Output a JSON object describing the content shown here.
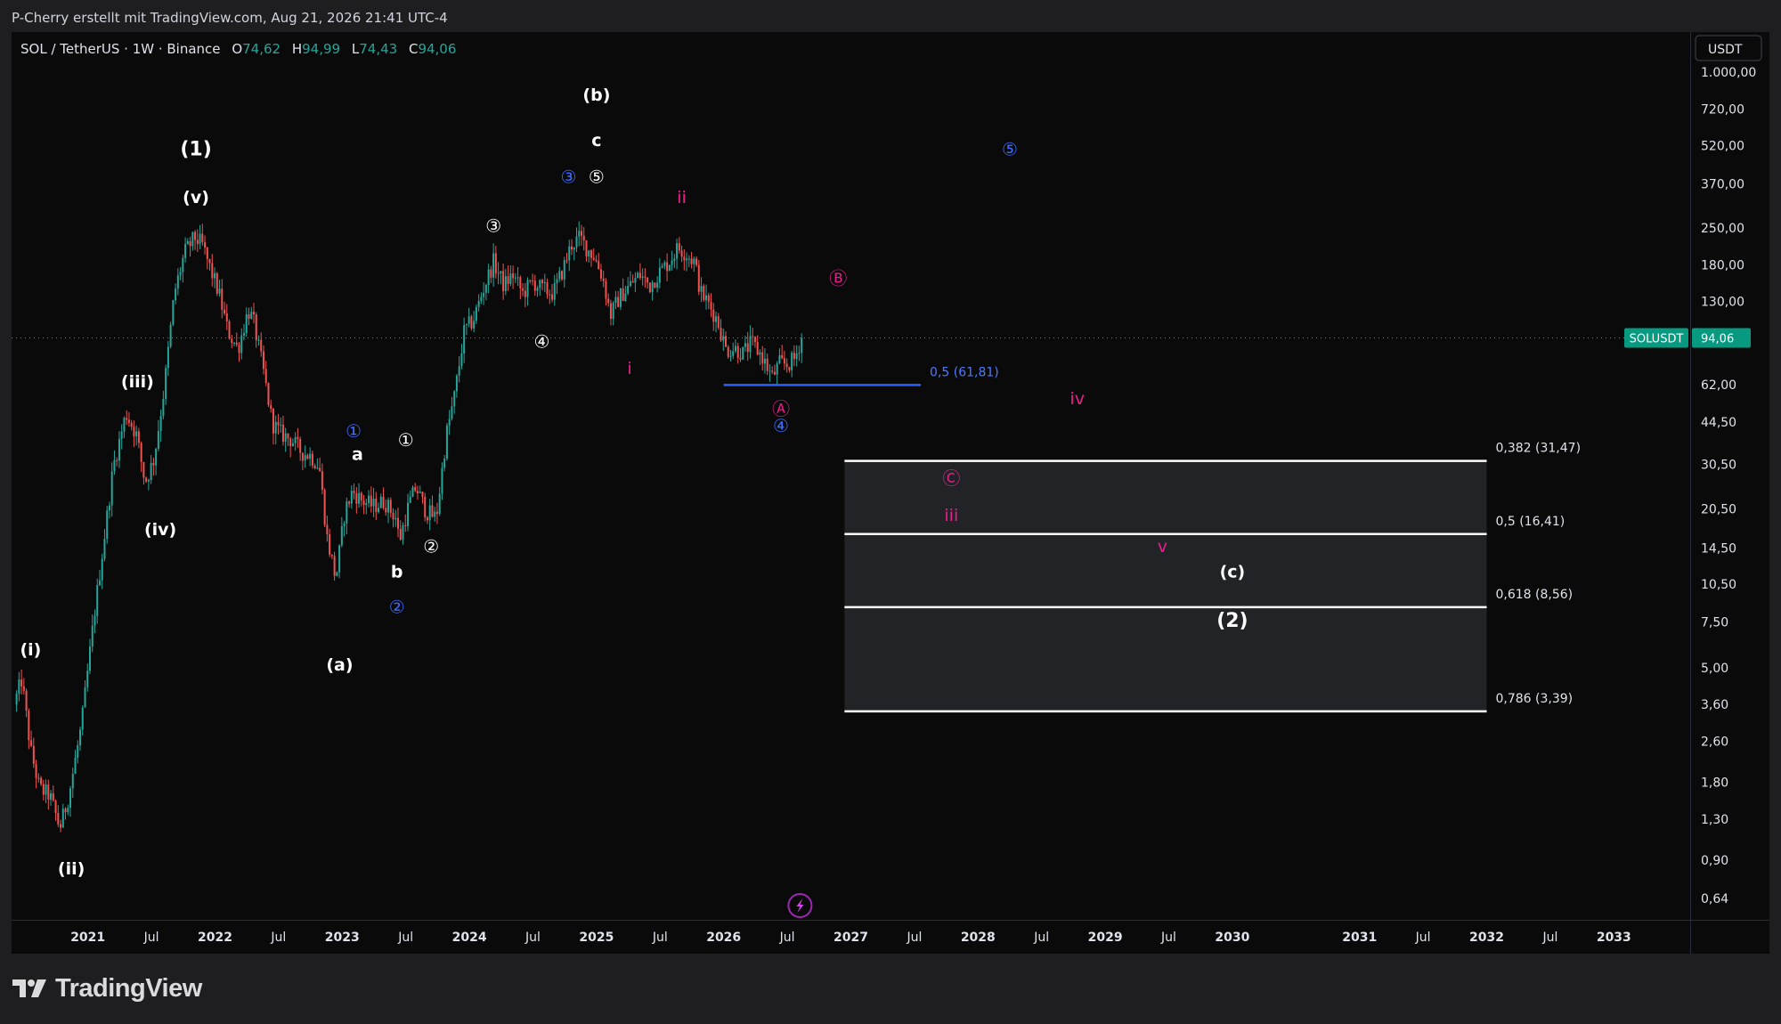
{
  "header": {
    "attribution": "P-Cherry erstellt mit TradingView.com, Aug 21, 2026 21:41 UTC-4"
  },
  "legend": {
    "symbol": "SOL / TetherUS · 1W · Binance",
    "open_label": "O",
    "open": "74,62",
    "high_label": "H",
    "high": "94,99",
    "low_label": "L",
    "low": "74,43",
    "close_label": "C",
    "close": "94,06"
  },
  "footer": {
    "brand": "TradingView"
  },
  "colors": {
    "background": "#0a0a0b",
    "frame": "#1e1e21",
    "up": "#26a69a",
    "down": "#ef5350",
    "text": "#e0e3eb",
    "blue": "#2962ff",
    "magenta": "#e91e8c",
    "price_tag": "#089981"
  },
  "chart_data": {
    "type": "candlestick",
    "scale": "log",
    "currency": "USDT",
    "x_range": [
      2020.4,
      2033.6
    ],
    "y_range": [
      0.53,
      1430
    ],
    "y_ticks": [
      {
        "v": 1000,
        "label": "1.000,00"
      },
      {
        "v": 720,
        "label": "720,00"
      },
      {
        "v": 520,
        "label": "520,00"
      },
      {
        "v": 370,
        "label": "370,00"
      },
      {
        "v": 250,
        "label": "250,00"
      },
      {
        "v": 180,
        "label": "180,00"
      },
      {
        "v": 130,
        "label": "130,00"
      },
      {
        "v": 62,
        "label": "62,00"
      },
      {
        "v": 44.5,
        "label": "44,50"
      },
      {
        "v": 30.5,
        "label": "30,50"
      },
      {
        "v": 20.5,
        "label": "20,50"
      },
      {
        "v": 14.5,
        "label": "14,50"
      },
      {
        "v": 10.5,
        "label": "10,50"
      },
      {
        "v": 7.5,
        "label": "7,50"
      },
      {
        "v": 5,
        "label": "5,00"
      },
      {
        "v": 3.6,
        "label": "3,60"
      },
      {
        "v": 2.6,
        "label": "2,60"
      },
      {
        "v": 1.8,
        "label": "1,80"
      },
      {
        "v": 1.3,
        "label": "1,30"
      },
      {
        "v": 0.9,
        "label": "0,90"
      },
      {
        "v": 0.64,
        "label": "0,64"
      }
    ],
    "x_ticks": [
      {
        "t": 2021,
        "label": "2021"
      },
      {
        "t": 2021.5,
        "label": "Jul"
      },
      {
        "t": 2022,
        "label": "2022"
      },
      {
        "t": 2022.5,
        "label": "Jul"
      },
      {
        "t": 2023,
        "label": "2023"
      },
      {
        "t": 2023.5,
        "label": "Jul"
      },
      {
        "t": 2024,
        "label": "2024"
      },
      {
        "t": 2024.5,
        "label": "Jul"
      },
      {
        "t": 2025,
        "label": "2025"
      },
      {
        "t": 2025.5,
        "label": "Jul"
      },
      {
        "t": 2026,
        "label": "2026"
      },
      {
        "t": 2026.5,
        "label": "Jul"
      },
      {
        "t": 2027,
        "label": "2027"
      },
      {
        "t": 2027.5,
        "label": "Jul"
      },
      {
        "t": 2028,
        "label": "2028"
      },
      {
        "t": 2028.5,
        "label": "Jul"
      },
      {
        "t": 2029,
        "label": "2029"
      },
      {
        "t": 2029.5,
        "label": "Jul"
      },
      {
        "t": 2030,
        "label": "2030"
      },
      {
        "t": 2031,
        "label": "2031"
      },
      {
        "t": 2031.5,
        "label": "Jul"
      },
      {
        "t": 2032,
        "label": "2032"
      },
      {
        "t": 2032.5,
        "label": "Jul"
      },
      {
        "t": 2033,
        "label": "2033"
      }
    ],
    "price_anchors": [
      [
        2020.42,
        3.6
      ],
      [
        2020.48,
        4.5
      ],
      [
        2020.55,
        2.4
      ],
      [
        2020.62,
        1.7
      ],
      [
        2020.7,
        1.6
      ],
      [
        2020.78,
        1.2
      ],
      [
        2020.85,
        1.6
      ],
      [
        2020.95,
        3.0
      ],
      [
        2021.05,
        8.0
      ],
      [
        2021.13,
        16
      ],
      [
        2021.2,
        30
      ],
      [
        2021.3,
        48
      ],
      [
        2021.38,
        40
      ],
      [
        2021.45,
        26
      ],
      [
        2021.52,
        32
      ],
      [
        2021.6,
        60
      ],
      [
        2021.68,
        140
      ],
      [
        2021.76,
        200
      ],
      [
        2021.84,
        230
      ],
      [
        2021.9,
        215
      ],
      [
        2021.96,
        175
      ],
      [
        2022.03,
        140
      ],
      [
        2022.1,
        100
      ],
      [
        2022.18,
        85
      ],
      [
        2022.26,
        120
      ],
      [
        2022.3,
        110
      ],
      [
        2022.38,
        70
      ],
      [
        2022.45,
        44
      ],
      [
        2022.52,
        40
      ],
      [
        2022.6,
        38
      ],
      [
        2022.68,
        34
      ],
      [
        2022.75,
        33
      ],
      [
        2022.82,
        30
      ],
      [
        2022.88,
        16
      ],
      [
        2022.95,
        11
      ],
      [
        2023.02,
        20
      ],
      [
        2023.08,
        24
      ],
      [
        2023.16,
        22
      ],
      [
        2023.25,
        21
      ],
      [
        2023.33,
        22
      ],
      [
        2023.42,
        19
      ],
      [
        2023.45,
        15.5
      ],
      [
        2023.52,
        21
      ],
      [
        2023.58,
        25
      ],
      [
        2023.66,
        20
      ],
      [
        2023.74,
        19
      ],
      [
        2023.82,
        40
      ],
      [
        2023.88,
        55
      ],
      [
        2023.96,
        100
      ],
      [
        2024.03,
        110
      ],
      [
        2024.11,
        145
      ],
      [
        2024.19,
        185
      ],
      [
        2024.27,
        150
      ],
      [
        2024.34,
        165
      ],
      [
        2024.42,
        140
      ],
      [
        2024.5,
        155
      ],
      [
        2024.57,
        145
      ],
      [
        2024.66,
        140
      ],
      [
        2024.74,
        175
      ],
      [
        2024.8,
        215
      ],
      [
        2024.87,
        230
      ],
      [
        2024.92,
        210
      ],
      [
        2024.98,
        195
      ],
      [
        2025.05,
        160
      ],
      [
        2025.11,
        115
      ],
      [
        2025.18,
        135
      ],
      [
        2025.26,
        150
      ],
      [
        2025.34,
        165
      ],
      [
        2025.42,
        150
      ],
      [
        2025.5,
        170
      ],
      [
        2025.57,
        185
      ],
      [
        2025.64,
        210
      ],
      [
        2025.7,
        200
      ],
      [
        2025.77,
        185
      ],
      [
        2025.82,
        140
      ],
      [
        2025.87,
        130
      ],
      [
        2025.95,
        110
      ],
      [
        2026.02,
        84
      ],
      [
        2026.08,
        86
      ],
      [
        2026.15,
        82
      ],
      [
        2026.22,
        90
      ],
      [
        2026.3,
        80
      ],
      [
        2026.38,
        66
      ],
      [
        2026.44,
        75
      ],
      [
        2026.5,
        74
      ],
      [
        2026.56,
        78
      ],
      [
        2026.61,
        94
      ]
    ],
    "last_price": {
      "value": 94.06,
      "symbol": "SOLUSDT",
      "label": "94,06"
    },
    "fib_line": {
      "value": 61.81,
      "x_start": 2026.0,
      "x_end": 2027.55,
      "label": "0,5 (61,81)"
    },
    "fib_box": {
      "x_start": 2026.95,
      "x_end": 2032.0,
      "levels": [
        {
          "v": 31.47,
          "label": "0,382 (31,47)"
        },
        {
          "v": 16.41,
          "label": "0,5 (16,41)"
        },
        {
          "v": 8.56,
          "label": "0,618 (8,56)"
        },
        {
          "v": 3.39,
          "label": "0,786 (3,39)"
        }
      ]
    },
    "wave_labels": [
      {
        "text": "(1)",
        "t": 2021.85,
        "v": 505,
        "color": "white",
        "big": true
      },
      {
        "text": "(v)",
        "t": 2021.85,
        "v": 330,
        "color": "white"
      },
      {
        "text": "(iii)",
        "t": 2021.39,
        "v": 64,
        "color": "white"
      },
      {
        "text": "(iv)",
        "t": 2021.57,
        "v": 17.2,
        "color": "white"
      },
      {
        "text": "(i)",
        "t": 2020.55,
        "v": 5.9,
        "color": "white"
      },
      {
        "text": "(ii)",
        "t": 2020.87,
        "v": 0.84,
        "color": "white"
      },
      {
        "text": "(a)",
        "t": 2022.98,
        "v": 5.15,
        "color": "white"
      },
      {
        "text": "(b)",
        "t": 2025.0,
        "v": 820,
        "color": "white"
      },
      {
        "text": "c",
        "t": 2025.0,
        "v": 548,
        "color": "white"
      },
      {
        "text": "a",
        "t": 2023.12,
        "v": 33.5,
        "color": "white"
      },
      {
        "text": "b",
        "t": 2023.43,
        "v": 11.8,
        "color": "white"
      },
      {
        "text": "(c)",
        "t": 2030.0,
        "v": 11.8,
        "color": "white"
      },
      {
        "text": "(2)",
        "t": 2030.0,
        "v": 7.6,
        "color": "white",
        "big": true
      },
      {
        "text": "ii",
        "t": 2025.67,
        "v": 330,
        "color": "magenta"
      },
      {
        "text": "i",
        "t": 2025.26,
        "v": 72,
        "color": "magenta"
      },
      {
        "text": "iv",
        "t": 2028.78,
        "v": 55,
        "color": "magenta"
      },
      {
        "text": "iii",
        "t": 2027.79,
        "v": 19.5,
        "color": "magenta"
      },
      {
        "text": "v",
        "t": 2029.45,
        "v": 14.8,
        "color": "magenta"
      }
    ],
    "circled_labels": [
      {
        "text": "③",
        "t": 2024.19,
        "v": 255,
        "color": "white"
      },
      {
        "text": "⑤",
        "t": 2025.0,
        "v": 395,
        "color": "white"
      },
      {
        "text": "③",
        "t": 2024.78,
        "v": 395,
        "color": "blue"
      },
      {
        "text": "④",
        "t": 2024.57,
        "v": 91,
        "color": "white"
      },
      {
        "text": "①",
        "t": 2023.09,
        "v": 41,
        "color": "blue"
      },
      {
        "text": "①",
        "t": 2023.5,
        "v": 38,
        "color": "white"
      },
      {
        "text": "②",
        "t": 2023.7,
        "v": 14.7,
        "color": "white"
      },
      {
        "text": "②",
        "t": 2023.43,
        "v": 8.6,
        "color": "blue"
      },
      {
        "text": "Ⓐ",
        "t": 2026.45,
        "v": 50,
        "color": "magenta"
      },
      {
        "text": "④",
        "t": 2026.45,
        "v": 43,
        "color": "blue"
      },
      {
        "text": "Ⓑ",
        "t": 2026.9,
        "v": 160,
        "color": "magenta"
      },
      {
        "text": "⑤",
        "t": 2028.25,
        "v": 505,
        "color": "blue"
      },
      {
        "text": "Ⓒ",
        "t": 2027.79,
        "v": 27,
        "color": "magenta"
      }
    ]
  }
}
